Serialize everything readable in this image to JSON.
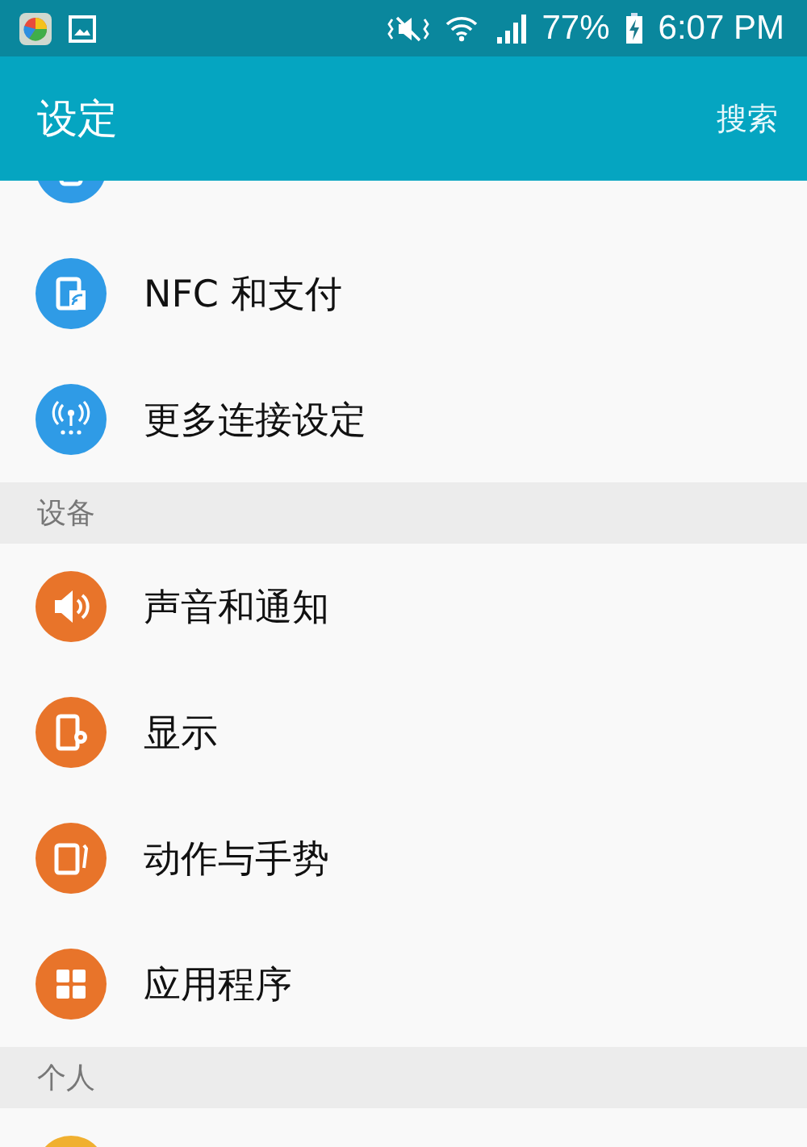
{
  "status_bar": {
    "battery": "77%",
    "time": "6:07 PM"
  },
  "app_bar": {
    "title": "设定",
    "action": "搜索"
  },
  "sections": [
    {
      "items": [
        {
          "color": "#2f9be6"
        },
        {
          "label": "NFC 和支付",
          "color": "#2f9be6"
        },
        {
          "label": "更多连接设定",
          "color": "#2f9be6"
        }
      ]
    },
    {
      "header": "设备",
      "items": [
        {
          "label": "声音和通知",
          "color": "#e8742a"
        },
        {
          "label": "显示",
          "color": "#e8742a"
        },
        {
          "label": "动作与手势",
          "color": "#e8742a"
        },
        {
          "label": "应用程序",
          "color": "#e8742a"
        }
      ]
    },
    {
      "header": "个人",
      "items": [
        {
          "color": "#f0b030"
        }
      ]
    }
  ]
}
